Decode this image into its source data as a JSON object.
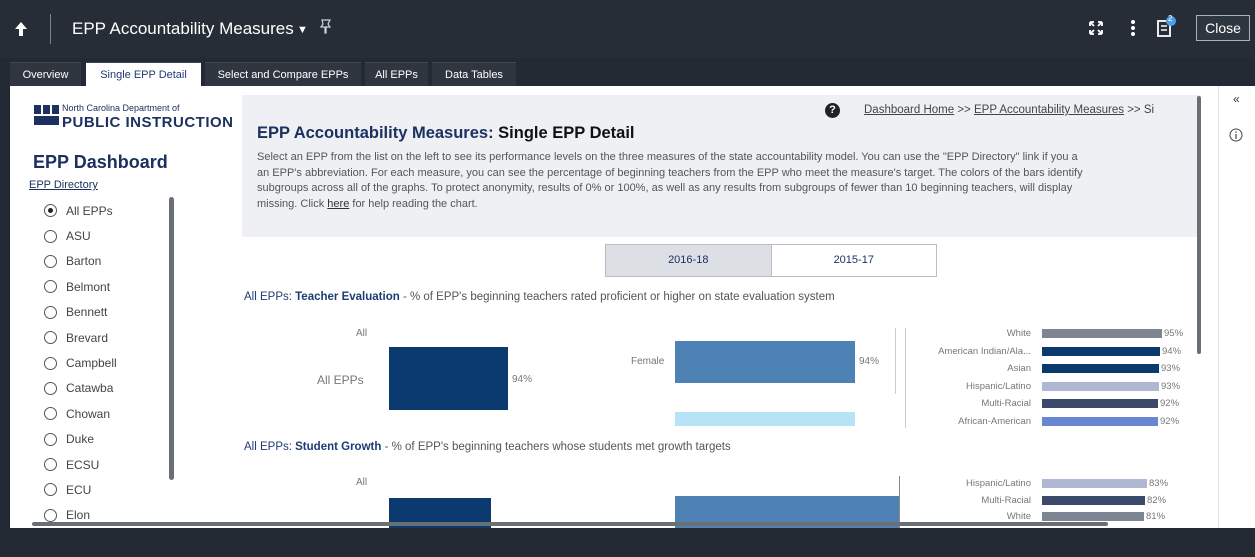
{
  "header": {
    "title": "EPP Accountability Measures",
    "notification_count": "2",
    "close_label": "Close"
  },
  "tabs": [
    {
      "label": "Overview"
    },
    {
      "label": "Single EPP Detail"
    },
    {
      "label": "Select and Compare EPPs"
    },
    {
      "label": "All EPPs"
    },
    {
      "label": "Data Tables"
    }
  ],
  "sidebar": {
    "logo_line1": "North Carolina Department of",
    "logo_line2": "PUBLIC INSTRUCTION",
    "title": "EPP Dashboard",
    "directory_link": "EPP Directory",
    "selected": "All EPPs",
    "options": [
      "All EPPs",
      "ASU",
      "Barton",
      "Belmont",
      "Bennett",
      "Brevard",
      "Campbell",
      "Catawba",
      "Chowan",
      "Duke",
      "ECSU",
      "ECU",
      "Elon"
    ]
  },
  "main": {
    "breadcrumb_home": "Dashboard Home",
    "breadcrumb_sep": ">>",
    "breadcrumb_current": "EPP Accountability Measures",
    "breadcrumb_tail": "Si",
    "title_prefix": "EPP Accountability Measures:",
    "title_suffix": "Single EPP Detail",
    "desc_line1": "Select an EPP from the list on the left to see its performance levels on the three measures of the state accountability model. You can use the \"EPP Directory\" link if you a",
    "desc_line2": "an EPP's abbreviation. For each measure, you can see the percentage of beginning teachers from the EPP who meet the measure's target. The colors of the bars identify",
    "desc_line3": "subgroups across all of the graphs. To protect anonymity, results of 0% or 100%, as well as any results from subgroups of fewer than 10 beginning teachers, will display",
    "desc_line4_a": "missing. Click ",
    "desc_line4_link": "here",
    "desc_line4_b": " for help reading the chart.",
    "years": [
      "2016-18",
      "2015-17"
    ]
  },
  "colors": {
    "navy": "#0b3a6e",
    "steel": "#4e82b4",
    "light_blue": "#b7e3f7",
    "gray": "#7d8592",
    "slate": "#3b4a6b",
    "lavender": "#b0b7d3",
    "periwinkle": "#6a86d0"
  },
  "teacher_eval": {
    "epp_label": "All EPPs:",
    "measure": "Teacher Evaluation",
    "desc": " - % of EPP's beginning teachers rated proficient or higher on state evaluation system",
    "all_header": "All",
    "all_label": "All EPPs",
    "all_value": "94%",
    "gender_label": "Female",
    "gender_value": "94%",
    "race": [
      {
        "label": "White",
        "value": "95%"
      },
      {
        "label": "American Indian/Ala...",
        "value": "94%"
      },
      {
        "label": "Asian",
        "value": "93%"
      },
      {
        "label": "Hispanic/Latino",
        "value": "93%"
      },
      {
        "label": "Multi-Racial",
        "value": "92%"
      },
      {
        "label": "African-American",
        "value": "92%"
      }
    ]
  },
  "student_growth": {
    "epp_label": "All EPPs:",
    "measure": "Student Growth",
    "desc": " - % of EPP's beginning teachers whose students met growth targets",
    "all_header": "All",
    "race": [
      {
        "label": "Hispanic/Latino",
        "value": "83%"
      },
      {
        "label": "Multi-Racial",
        "value": "82%"
      },
      {
        "label": "White",
        "value": "81%"
      }
    ]
  }
}
